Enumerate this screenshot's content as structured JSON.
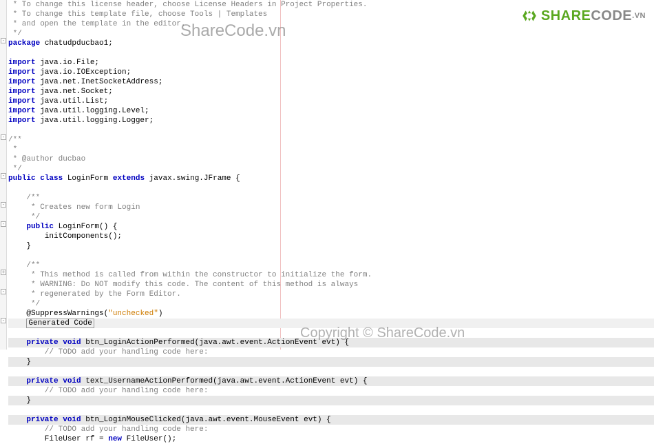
{
  "watermarks": {
    "top": "ShareCode.vn",
    "bottom": "Copyright © ShareCode.vn"
  },
  "logo": {
    "share": "SHARE",
    "code": "CODE",
    "suffix": ".VN"
  },
  "code": {
    "c1": " * To change this license header, choose License Headers in Project Properties.",
    "c2": " * To change this template file, choose Tools | Templates",
    "c3": " * and open the template in the editor.",
    "c4": " */",
    "pkg_kw": "package",
    "pkg_name": " chatudpducbao1;",
    "imp_kw": "import",
    "imp1": " java.io.File;",
    "imp2": " java.io.IOException;",
    "imp3": " java.net.InetSocketAddress;",
    "imp4": " java.net.Socket;",
    "imp5": " java.util.List;",
    "imp6": " java.util.logging.Level;",
    "imp7": " java.util.logging.Logger;",
    "jd_open": "/**",
    "jd_star": " *",
    "jd_author": " * @author ducbao",
    "jd_close": " */",
    "public_kw": "public",
    "class_kw": "class",
    "class_name": " LoginForm ",
    "extends_kw": "extends",
    "class_ext": " javax.swing.JFrame {",
    "jd2_open": "    /**",
    "jd2_body": "     * Creates new form Login",
    "jd2_close": "     */",
    "ctor_sig_pre": "    ",
    "ctor_name": " LoginForm() {",
    "ctor_body": "        initComponents();",
    "close_brace": "    }",
    "jd3_open": "    /**",
    "jd3_l1": "     * This method is called from within the constructor to initialize the form.",
    "jd3_l2": "     * WARNING: Do NOT modify this code. The content of this method is always",
    "jd3_l3": "     * regenerated by the Form Editor.",
    "jd3_close": "     */",
    "supp_pre": "    @SuppressWarnings(",
    "supp_str": "\"unchecked\"",
    "supp_post": ")",
    "gen_pre": "    ",
    "gen_code": "Generated Code",
    "m1_pre": "    ",
    "priv_kw": "private",
    "void_kw": "void",
    "m1_name": " btn_LoginActionPerformed(java.awt.event.ActionEvent evt) {",
    "todo": "        // TODO add your handling code here:",
    "m_close": "    }",
    "m2_name": " text_UsernameActionPerformed(java.awt.event.ActionEvent evt) {",
    "m3_name": " btn_LoginMouseClicked(java.awt.event.MouseEvent evt) {",
    "m3_body_pre": "        FileUser rf = ",
    "new_kw": "new",
    "m3_body_post": " FileUser();"
  }
}
